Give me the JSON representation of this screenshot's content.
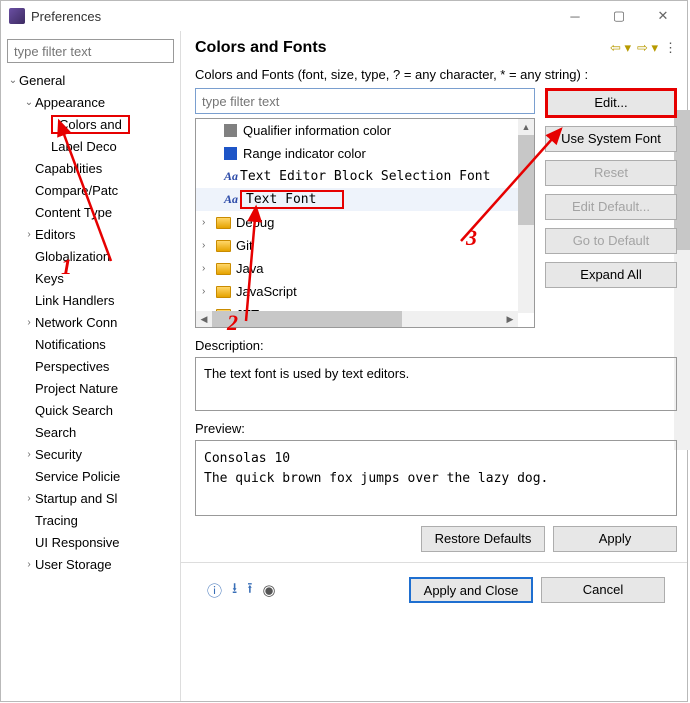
{
  "window": {
    "title": "Preferences"
  },
  "left": {
    "filter_placeholder": "type filter text",
    "tree": [
      {
        "label": "General",
        "lvl": 0,
        "caret": "v"
      },
      {
        "label": "Appearance",
        "lvl": 1,
        "caret": "v"
      },
      {
        "label": "Colors and",
        "lvl": 2,
        "hot": true
      },
      {
        "label": "Label Deco",
        "lvl": 2
      },
      {
        "label": "Capabilities",
        "lvl": 1
      },
      {
        "label": "Compare/Patc",
        "lvl": 1
      },
      {
        "label": "Content Type",
        "lvl": 1
      },
      {
        "label": "Editors",
        "lvl": 1,
        "caret": ">"
      },
      {
        "label": "Globalization",
        "lvl": 1
      },
      {
        "label": "Keys",
        "lvl": 1
      },
      {
        "label": "Link Handlers",
        "lvl": 1
      },
      {
        "label": "Network Conn",
        "lvl": 1,
        "caret": ">"
      },
      {
        "label": "Notifications",
        "lvl": 1
      },
      {
        "label": "Perspectives",
        "lvl": 1
      },
      {
        "label": "Project Nature",
        "lvl": 1
      },
      {
        "label": "Quick Search",
        "lvl": 1
      },
      {
        "label": "Search",
        "lvl": 1
      },
      {
        "label": "Security",
        "lvl": 1,
        "caret": ">"
      },
      {
        "label": "Service Policie",
        "lvl": 1
      },
      {
        "label": "Startup and Sl",
        "lvl": 1,
        "caret": ">"
      },
      {
        "label": "Tracing",
        "lvl": 1
      },
      {
        "label": "UI Responsive",
        "lvl": 1
      },
      {
        "label": "User Storage",
        "lvl": 1,
        "caret": ">"
      }
    ]
  },
  "right": {
    "heading": "Colors and Fonts",
    "instruction": "Colors and Fonts (font, size, type, ? = any character, * = any string) :",
    "filter_placeholder": "type filter text",
    "items": [
      {
        "kind": "sq-grey",
        "label": "Qualifier information color"
      },
      {
        "kind": "sq-blue",
        "label": "Range indicator color"
      },
      {
        "kind": "aa",
        "label": "Text Editor Block Selection Font",
        "mono": true
      },
      {
        "kind": "aa",
        "label": "Text Font",
        "mono": true,
        "selected": true
      },
      {
        "kind": "folder",
        "label": "Debug",
        "caret": ">"
      },
      {
        "kind": "folder",
        "label": "Git",
        "caret": ">"
      },
      {
        "kind": "folder",
        "label": "Java",
        "caret": ">"
      },
      {
        "kind": "folder",
        "label": "JavaScript",
        "caret": ">"
      },
      {
        "kind": "folder",
        "label": "JET",
        "caret": ">"
      }
    ],
    "buttons": {
      "edit": "Edit...",
      "use_system": "Use System Font",
      "reset": "Reset",
      "edit_default": "Edit Default...",
      "go_default": "Go to Default",
      "expand_all": "Expand All"
    },
    "desc_label": "Description:",
    "desc_text": "The text font is used by text editors.",
    "preview_label": "Preview:",
    "preview_text": "Consolas 10\nThe quick brown fox jumps over the lazy dog.",
    "restore": "Restore Defaults",
    "apply": "Apply"
  },
  "footer": {
    "apply_close": "Apply and Close",
    "cancel": "Cancel"
  },
  "annotations": {
    "n1": "1",
    "n2": "2",
    "n3": "3"
  }
}
